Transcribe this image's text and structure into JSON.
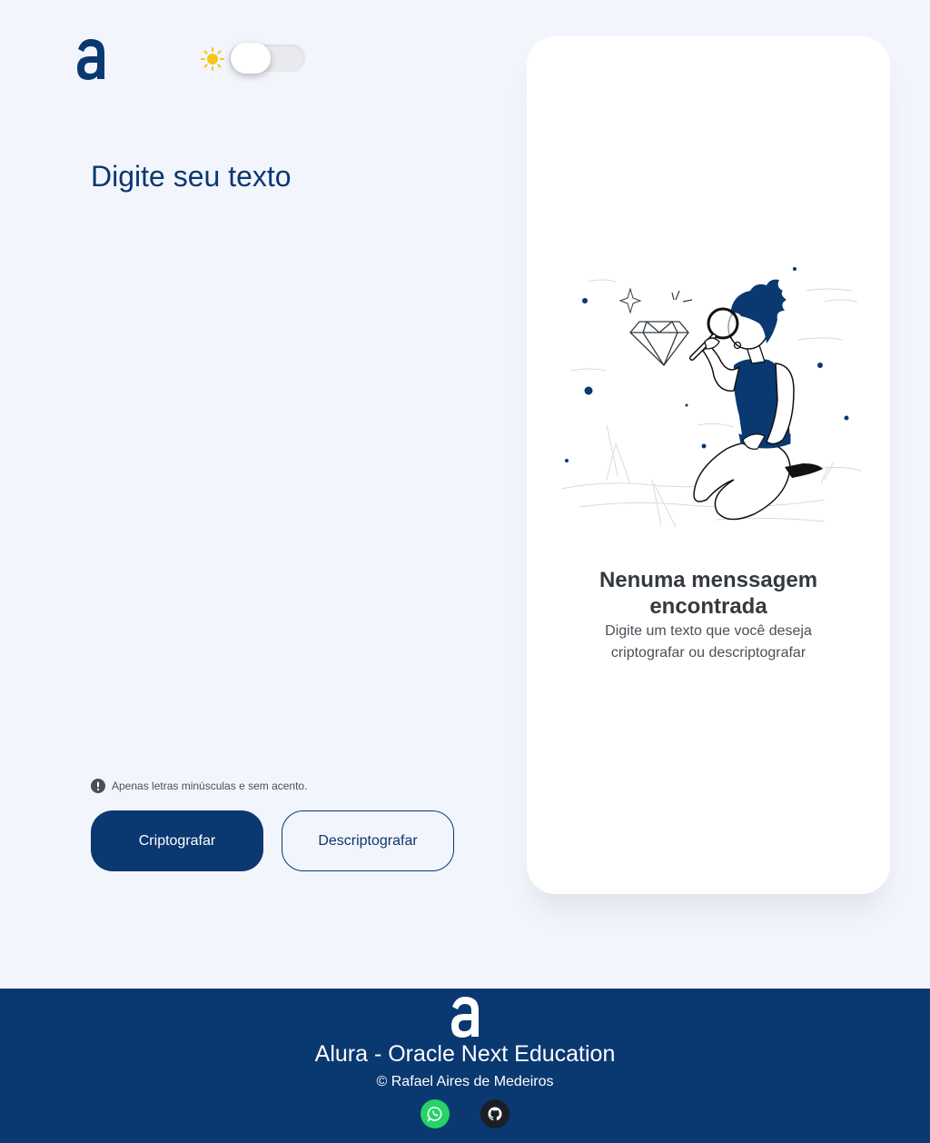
{
  "header": {
    "logo_icon": "alura-logo",
    "theme_icon": "sun-icon",
    "theme_mode": "light"
  },
  "input": {
    "placeholder": "Digite seu texto",
    "value": ""
  },
  "hint": {
    "icon": "exclamation-icon",
    "text": "Apenas letras minúsculas e sem acento."
  },
  "buttons": {
    "encrypt_label": "Criptografar",
    "decrypt_label": "Descriptografar"
  },
  "output": {
    "illustration": "person-with-magnifier-illustration",
    "title": "Nenuma menssagem encontrada",
    "description": "Digite um texto que você deseja criptografar ou descriptografar"
  },
  "footer": {
    "title": "Alura - Oracle Next Education",
    "credit": "© Rafael Aires de Medeiros",
    "social": [
      "whatsapp-icon",
      "github-icon"
    ]
  },
  "colors": {
    "primary": "#0a3871",
    "background": "#f3f5fc",
    "card": "#ffffff",
    "sun": "#f5c518",
    "whatsapp": "#25d366",
    "github": "#1b1f23"
  }
}
